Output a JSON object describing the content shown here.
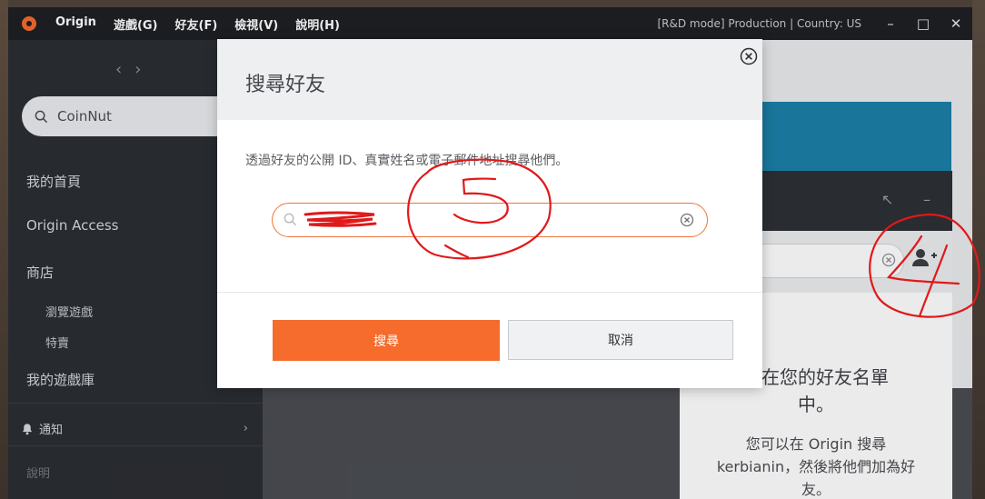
{
  "titlebar": {
    "app_name": "Origin",
    "menu": [
      "遊戲(G)",
      "好友(F)",
      "檢視(V)",
      "說明(H)"
    ],
    "status": "[R&D mode] Production | Country: US"
  },
  "sidebar": {
    "search_value": "CoinNut",
    "items": {
      "home": "我的首頁",
      "access": "Origin Access",
      "store": "商店",
      "browse": "瀏覽遊戲",
      "deals": "特賣",
      "library": "我的遊戲庫"
    },
    "notifications": "通知",
    "help": "說明"
  },
  "friends_panel": {
    "empty_title_line1": "不在您的好友名單",
    "empty_title_line2": "中。",
    "empty_body_line1": "您可以在 Origin 搜尋",
    "empty_body_line2": "kerbianin，然後將他們加為好",
    "empty_body_line3": "友。"
  },
  "dialog": {
    "title": "搜尋好友",
    "description": "透過好友的公開 ID、真實姓名或電子郵件地址搜尋他們。",
    "input_value": "",
    "search_label": "搜尋",
    "cancel_label": "取消"
  },
  "annotations": {
    "number_4": "4",
    "number_5": "5"
  },
  "colors": {
    "accent": "#f56c2d",
    "annotation": "#e0191b"
  }
}
